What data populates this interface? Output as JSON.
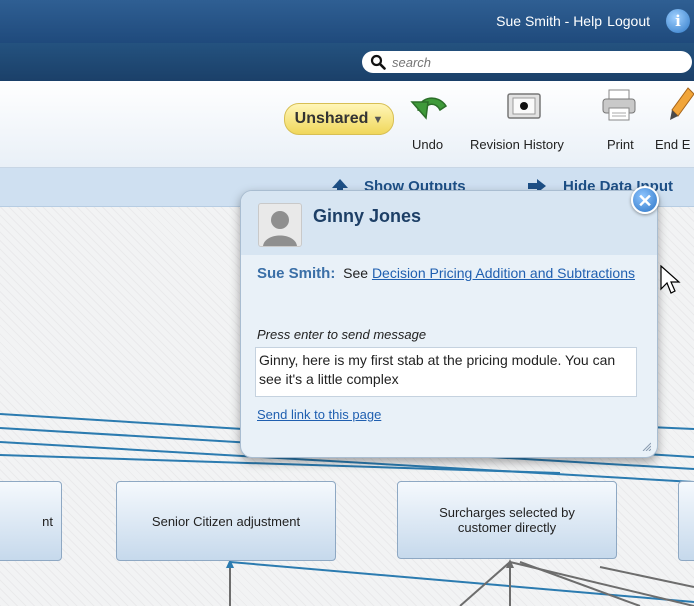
{
  "header": {
    "user_help": "Sue Smith - Help",
    "logout": "Logout",
    "info_icon": "info-icon"
  },
  "search": {
    "placeholder": "search"
  },
  "toolbar": {
    "sharing_label": "Unshared",
    "undo_label": "Undo",
    "revision_label": "Revision History",
    "print_label": "Print",
    "end_label": "End E"
  },
  "bluebar": {
    "show_outputs": "Show Outputs",
    "hide_data_inputs": "Hide Data Input"
  },
  "popup": {
    "contact_name": "Ginny Jones",
    "sender": "Sue Smith:",
    "message_prefix": "See",
    "link_text": "Decision Pricing Addition and Subtractions",
    "hint": "Press enter to send message",
    "reply_text": "Ginny, here is my first stab at the pricing module.  You can see it's a little complex",
    "send_link": "Send link to this page"
  },
  "nodes": [
    {
      "label": "nt"
    },
    {
      "label": "Senior Citizen adjustment"
    },
    {
      "label": "Surcharges selected by customer directly"
    }
  ]
}
